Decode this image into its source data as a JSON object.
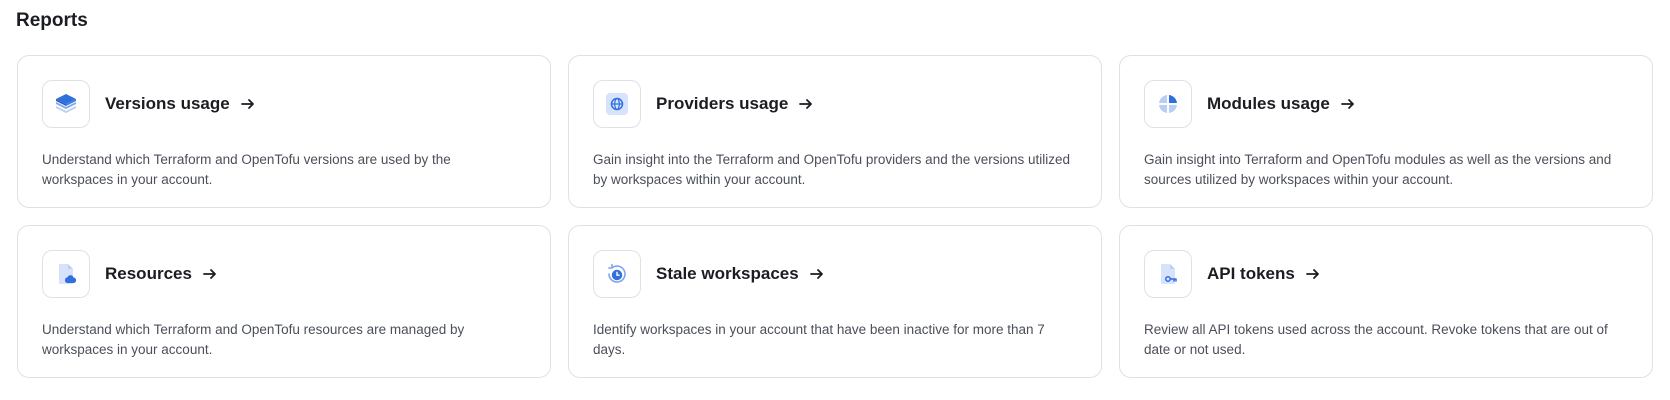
{
  "page": {
    "title": "Reports"
  },
  "colors": {
    "accent": "#2f6fde",
    "accent_light": "#b9cff5",
    "border": "#dfe1e6"
  },
  "cards": [
    {
      "title": "Versions usage",
      "description": "Understand which Terraform and OpenTofu versions are used by the workspaces in your account.",
      "icon": "layers-icon"
    },
    {
      "title": "Providers usage",
      "description": "Gain insight into the Terraform and OpenTofu providers and the versions utilized by workspaces within your account.",
      "icon": "globe-icon"
    },
    {
      "title": "Modules usage",
      "description": "Gain insight into Terraform and OpenTofu modules as well as the versions and sources utilized by workspaces within your account.",
      "icon": "pie-chart-icon"
    },
    {
      "title": "Resources",
      "description": "Understand which Terraform and OpenTofu resources are managed by workspaces in your account.",
      "icon": "document-cloud-icon"
    },
    {
      "title": "Stale workspaces",
      "description": "Identify workspaces in your account that have been inactive for more than 7 days.",
      "icon": "clock-history-icon"
    },
    {
      "title": "API tokens",
      "description": "Review all API tokens used across the account. Revoke tokens that are out of date or not used.",
      "icon": "document-key-icon"
    }
  ]
}
